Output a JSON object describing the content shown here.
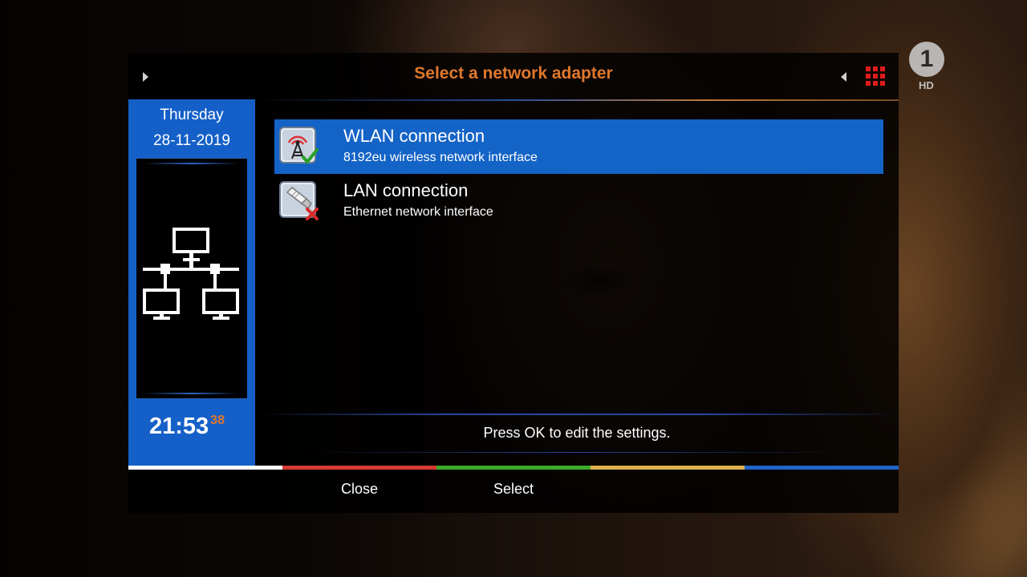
{
  "dialog": {
    "title": "Select a network adapter"
  },
  "channel": {
    "logo_text": "1",
    "hd_label": "HD"
  },
  "sidepanel": {
    "day": "Thursday",
    "date": "28-11-2019",
    "clock_time": "21:53",
    "clock_seconds": "38",
    "preview_icon": "network-topology-icon"
  },
  "adapters": [
    {
      "title": "WLAN connection",
      "subtitle": "8192eu wireless network interface",
      "icon": "wlan-antenna-icon",
      "status_icon": "check-icon",
      "selected": true
    },
    {
      "title": "LAN connection",
      "subtitle": "Ethernet network interface",
      "icon": "ethernet-plug-icon",
      "status_icon": "cross-icon",
      "selected": false
    }
  ],
  "hint": "Press OK to edit the settings.",
  "keys": {
    "red_label": "Close",
    "green_label": "Select",
    "yellow_label": "",
    "blue_label": ""
  },
  "colors": {
    "title_accent": "#e0782c",
    "selection": "#1463c6",
    "panel": "#1560c8",
    "key_white": "#ffffff",
    "key_red": "#d63a34",
    "key_green": "#3caa2a",
    "key_yellow": "#dcb04c",
    "key_blue": "#2064c8"
  }
}
